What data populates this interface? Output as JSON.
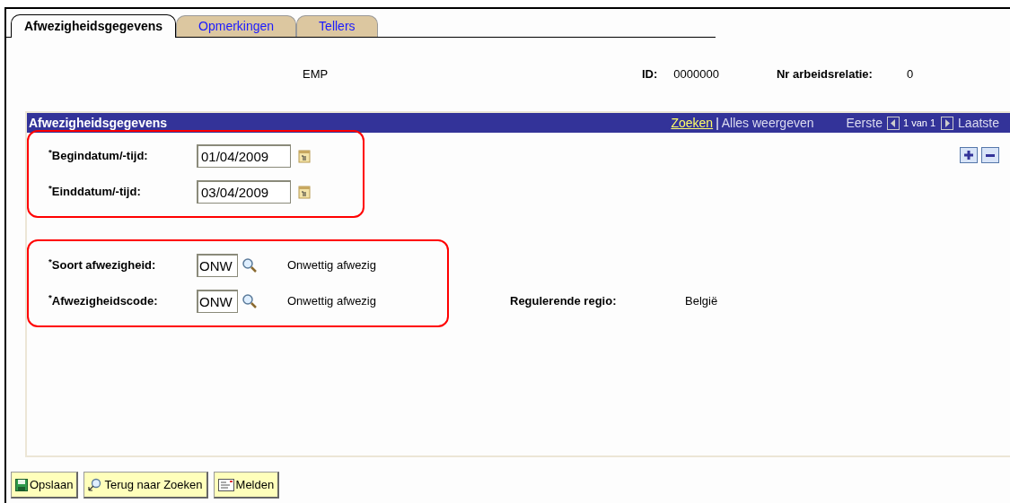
{
  "tabs": [
    {
      "label": "Afwezigheidsgegevens",
      "selected": true
    },
    {
      "label": "Opmerkingen",
      "selected": false
    },
    {
      "label": "Tellers",
      "selected": false
    }
  ],
  "header": {
    "name": "EMP",
    "id_label": "ID:",
    "id_value": "0000000",
    "relation_label": "Nr arbeidsrelatie:",
    "relation_value": "0"
  },
  "section": {
    "title": "Afwezigheidsgegevens",
    "search_link": "Zoeken",
    "separator": "|",
    "show_all": "Alles weergeven",
    "first": "Eerste",
    "counter": "1 van 1",
    "last": "Laatste"
  },
  "groups": [
    {
      "fields": [
        {
          "kind": "date",
          "label": "$^{*}$Begindatum/-tijd:",
          "value": "01/04/2009"
        },
        {
          "kind": "date",
          "label": "$^{*}$Einddatum/-tijd:",
          "value": "03/04/2009"
        }
      ]
    },
    {
      "fields": [
        {
          "kind": "lookup",
          "label": "$^{*}$Soort afwezigheid:",
          "value": "ONW",
          "description": "Onwettig afwezig"
        },
        {
          "kind": "lookup",
          "label": "$^{*}$Afwezigheidscode:",
          "value": "ONW",
          "description": "Onwettig afwezig",
          "side_label": "Regulerende regio:",
          "side_value": "België"
        }
      ]
    }
  ],
  "buttons": [
    {
      "kind": "save",
      "label": "Opslaan"
    },
    {
      "kind": "return",
      "label": "Terug naar Zoeken"
    },
    {
      "kind": "notify",
      "label": "Melden"
    }
  ]
}
